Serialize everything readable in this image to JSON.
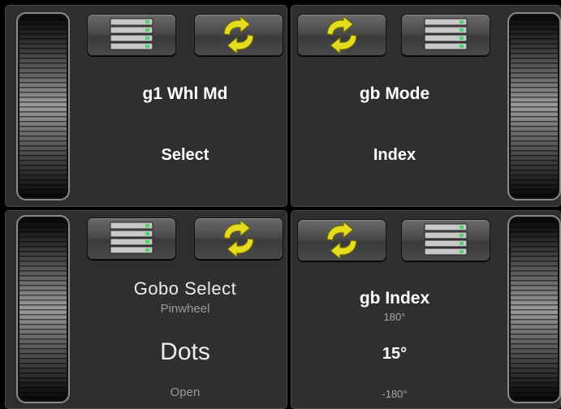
{
  "panels": {
    "top_left": {
      "title": "g1 Whl Md",
      "value": "Select",
      "buttons": [
        "list-icon",
        "refresh-icon"
      ]
    },
    "top_right": {
      "title": "gb Mode",
      "value": "Index",
      "buttons": [
        "refresh-icon",
        "list-icon"
      ]
    },
    "bottom_left": {
      "title": "Gobo Select",
      "prev": "Pinwheel",
      "value": "Dots",
      "next": "Open",
      "buttons": [
        "list-icon",
        "refresh-icon"
      ]
    },
    "bottom_right": {
      "title": "gb Index",
      "max": "180°",
      "value": "15°",
      "min": "-180°",
      "buttons": [
        "refresh-icon",
        "list-icon"
      ]
    }
  },
  "colors": {
    "panel_bg": "#2f2f2f",
    "refresh_icon": "#e6dc1f",
    "list_icon": "#c8c8c8",
    "list_indicator": "#4fd36a"
  }
}
